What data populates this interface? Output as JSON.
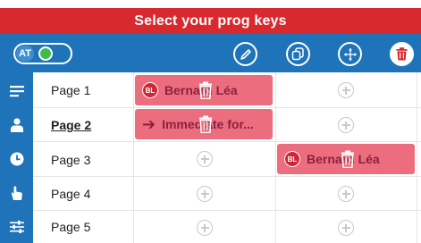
{
  "title": "Select your prog keys",
  "toolbar": {
    "at_label": "AT",
    "buttons": [
      {
        "name": "edit-button",
        "icon": "pencil-icon"
      },
      {
        "name": "copy-button",
        "icon": "copy-icon"
      },
      {
        "name": "move-button",
        "icon": "move-icon"
      },
      {
        "name": "delete-button",
        "icon": "trash-icon"
      }
    ]
  },
  "pages": [
    {
      "label": "Page 1",
      "icon": "list-icon",
      "active": false
    },
    {
      "label": "Page 2",
      "icon": "user-icon",
      "active": true
    },
    {
      "label": "Page 3",
      "icon": "clock-icon",
      "active": false
    },
    {
      "label": "Page 4",
      "icon": "hand-icon",
      "active": false
    },
    {
      "label": "Page 5",
      "icon": "sliders-icon",
      "active": false
    }
  ],
  "keys": {
    "p1c1": {
      "badge": "BL",
      "text": "Bernard Léa"
    },
    "p2c1": {
      "text": "Immediate for..."
    },
    "p3c2": {
      "badge": "BL",
      "text": "Bernard Léa"
    }
  },
  "colors": {
    "title_bg": "#d8292f",
    "toolbar_bg": "#1f73b9",
    "key_bg": "#ec6e7e",
    "key_text": "#8c2140",
    "toggle_on": "#3dbb4d"
  }
}
